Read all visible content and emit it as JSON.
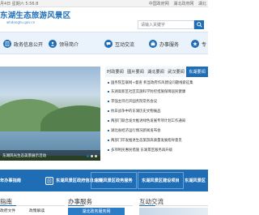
{
  "topbar": {
    "date": "月4日 星期六 5:56:8",
    "links": [
      "中国政府网",
      "湖北政府网",
      "湖北"
    ]
  },
  "header": {
    "logo": "东湖生态旅游风景区",
    "logo_sub": "whdonghu.gov.cn",
    "search_placeholder": "请输入关键字"
  },
  "nav": {
    "items": [
      {
        "label": "政务信息公开",
        "icon": "document-icon"
      },
      {
        "label": "领导简介",
        "icon": "user-icon"
      },
      {
        "label": "互动交流",
        "icon": "chat-icon"
      },
      {
        "label": "办事服务",
        "icon": "briefcase-icon"
      },
      {
        "label": "专",
        "icon": "star-icon"
      }
    ]
  },
  "banner": {
    "caption": "东湖风光生态美景展示活动"
  },
  "tabs": [
    "时政要闻",
    "图片要闻",
    "湖北要闻",
    "武汉要闻",
    "东湖要闻"
  ],
  "news": [
    "国务院互联网+督查 彰显政府作风建设问题线索征集",
    "东湖高新区社区实施科学防控措施保障居民健康",
    "李强主持召开国务院常务会议",
    "抗日战争中的东湖历史文物展品",
    "两部门联合发文推进绿色发展专项计划工作通知",
    "湖北省经济运行情况新闻发布会",
    "两部门印发推进生态旅游高质量发展指导意见",
    "多项利民惠民措施 东湖景区服务再升级"
  ],
  "strip": {
    "items": [
      {
        "label": "年办事指南",
        "icon": "guide-icon"
      },
      {
        "label": "东湖风景区政府信息公开",
        "icon": "info-icon"
      },
      {
        "label": "东湖风景区政务服务",
        "icon": "service-icon"
      },
      {
        "label": "东湖风景区建设项目",
        "icon": "building-icon"
      },
      {
        "label": "东湖风景区",
        "icon": "map-icon"
      }
    ]
  },
  "bottom": {
    "left_title": "指南",
    "left_items": [
      "政府文件",
      "政策解读",
      "东湖风景区政府信息公开"
    ],
    "mid_title": "办事服务",
    "mid_promo": "湖北政务服务网",
    "right_title": "互动交流"
  }
}
